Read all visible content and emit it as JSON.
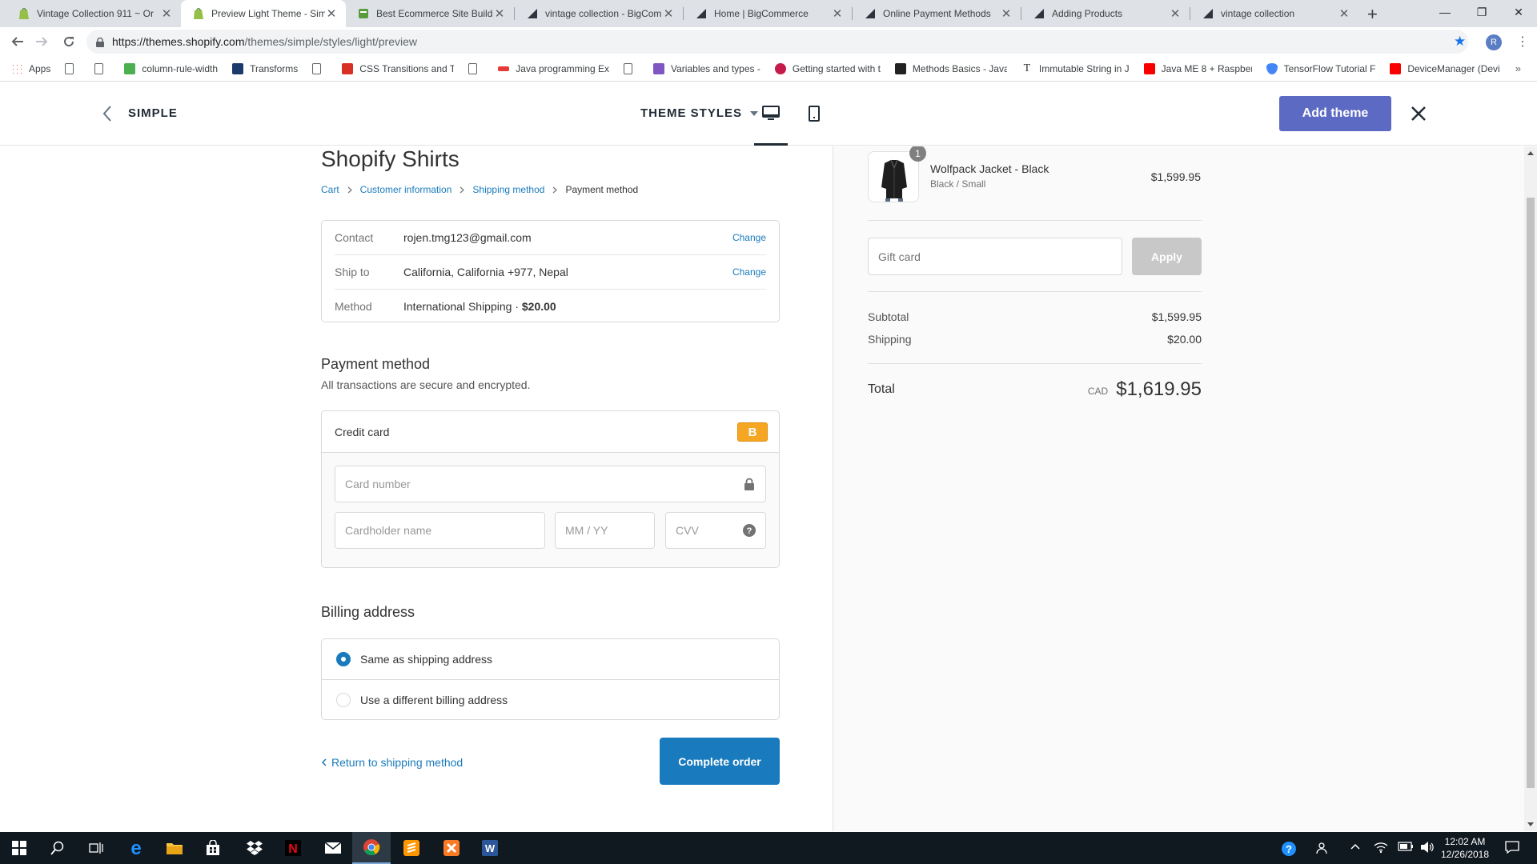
{
  "browser": {
    "tabs": [
      {
        "title": "Vintage Collection 911 ~ Or",
        "icon": "shopify-icon",
        "active": false
      },
      {
        "title": "Preview Light Theme - Simp",
        "icon": "shopify-icon",
        "active": true
      },
      {
        "title": "Best Ecommerce Site Builde",
        "icon": "page-icon",
        "active": false
      },
      {
        "title": "vintage collection - BigCom",
        "icon": "bigcommerce-icon",
        "active": false
      },
      {
        "title": "Home | BigCommerce",
        "icon": "bigcommerce-icon",
        "active": false
      },
      {
        "title": "Online Payment Methods",
        "icon": "bigcommerce-icon",
        "active": false
      },
      {
        "title": "Adding Products",
        "icon": "bigcommerce-icon",
        "active": false
      },
      {
        "title": "vintage collection",
        "icon": "bigcommerce-icon",
        "active": false
      }
    ],
    "url_host": "https://themes.shopify.com",
    "url_path": "/themes/simple/styles/light/preview",
    "profile_initial": "R",
    "bookmarks": [
      {
        "label": "Apps",
        "icon": "apps-icon"
      },
      {
        "label": "",
        "icon": "page-icon"
      },
      {
        "label": "",
        "icon": "page-icon"
      },
      {
        "label": "column-rule-width",
        "icon": "w3-icon"
      },
      {
        "label": "Transforms",
        "icon": "bookmark-icon"
      },
      {
        "label": "",
        "icon": "page-icon"
      },
      {
        "label": "CSS Transitions and T",
        "icon": "bookmark-icon"
      },
      {
        "label": "",
        "icon": "page-icon"
      },
      {
        "label": "Java programming Ex",
        "icon": "bookmark-icon"
      },
      {
        "label": "",
        "icon": "page-icon"
      },
      {
        "label": "Variables and types -",
        "icon": "bookmark-icon"
      },
      {
        "label": "Getting started with t",
        "icon": "raspberry-icon"
      },
      {
        "label": "Methods Basics - Java",
        "icon": "sf-icon"
      },
      {
        "label": "Immutable String in J",
        "icon": "t-icon"
      },
      {
        "label": "Java ME 8 + Raspberr",
        "icon": "oracle-icon"
      },
      {
        "label": "TensorFlow Tutorial F",
        "icon": "shield-icon"
      },
      {
        "label": "DeviceManager (Devi",
        "icon": "oracle-icon"
      }
    ],
    "bookmarks_more": "»"
  },
  "preview_header": {
    "theme_name": "SIMPLE",
    "styles_label": "THEME STYLES",
    "add_theme_label": "Add theme"
  },
  "checkout": {
    "store_title": "Shopify Shirts",
    "breadcrumb": [
      "Cart",
      "Customer information",
      "Shipping method",
      "Payment method"
    ],
    "review": [
      {
        "label": "Contact",
        "value": "rojen.tmg123@gmail.com",
        "action": "Change"
      },
      {
        "label": "Ship to",
        "value": "California, California +977, Nepal",
        "action": "Change"
      },
      {
        "label": "Method",
        "value": "International Shipping · ",
        "value_bold": "$20.00",
        "action": ""
      }
    ],
    "payment_title": "Payment method",
    "payment_subtitle": "All transactions are secure and encrypted.",
    "credit_card_label": "Credit card",
    "payment_badge": "B",
    "card_number_placeholder": "Card number",
    "cardholder_placeholder": "Cardholder name",
    "expiry_placeholder": "MM / YY",
    "cvv_placeholder": "CVV",
    "billing_title": "Billing address",
    "billing_options": [
      {
        "label": "Same as shipping address",
        "selected": true
      },
      {
        "label": "Use a different billing address",
        "selected": false
      }
    ],
    "return_link": "Return to shipping method",
    "complete_label": "Complete order"
  },
  "summary": {
    "product_name": "Wolfpack Jacket - Black",
    "product_variant": "Black / Small",
    "product_price": "$1,599.95",
    "quantity": "1",
    "gift_placeholder": "Gift card",
    "apply_label": "Apply",
    "subtotal_label": "Subtotal",
    "subtotal_value": "$1,599.95",
    "shipping_label": "Shipping",
    "shipping_value": "$20.00",
    "total_label": "Total",
    "total_currency": "CAD",
    "total_value": "$1,619.95"
  },
  "taskbar": {
    "time": "12:02 AM",
    "date": "12/26/2018"
  },
  "colors": {
    "accent_link": "#197bbd",
    "add_theme_bg": "#5c6ac4",
    "badge_orange": "#f5a623",
    "apply_disabled": "#c8c8c8"
  }
}
